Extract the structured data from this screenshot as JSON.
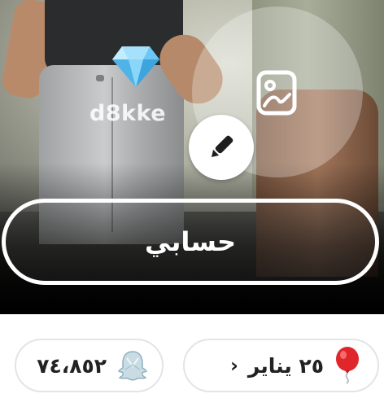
{
  "profile": {
    "username": "d8kke",
    "account_button_label": "حسابي"
  },
  "icons": {
    "badge": "diamond-icon",
    "edit": "pencil-icon",
    "change_photo": "gallery-icon",
    "birthday": "balloon-icon",
    "score": "ghost-icon",
    "chevron": "chevron-left-icon"
  },
  "chips": {
    "birthday_text": "٢٥ يناير",
    "chevron": "‹",
    "score_text": "٧٤،٨٥٢"
  },
  "colors": {
    "balloon": "#e0262b",
    "diamond": "#6cc7f4",
    "ghost": "#b9d0da",
    "chip_border": "#e3e4e6"
  }
}
